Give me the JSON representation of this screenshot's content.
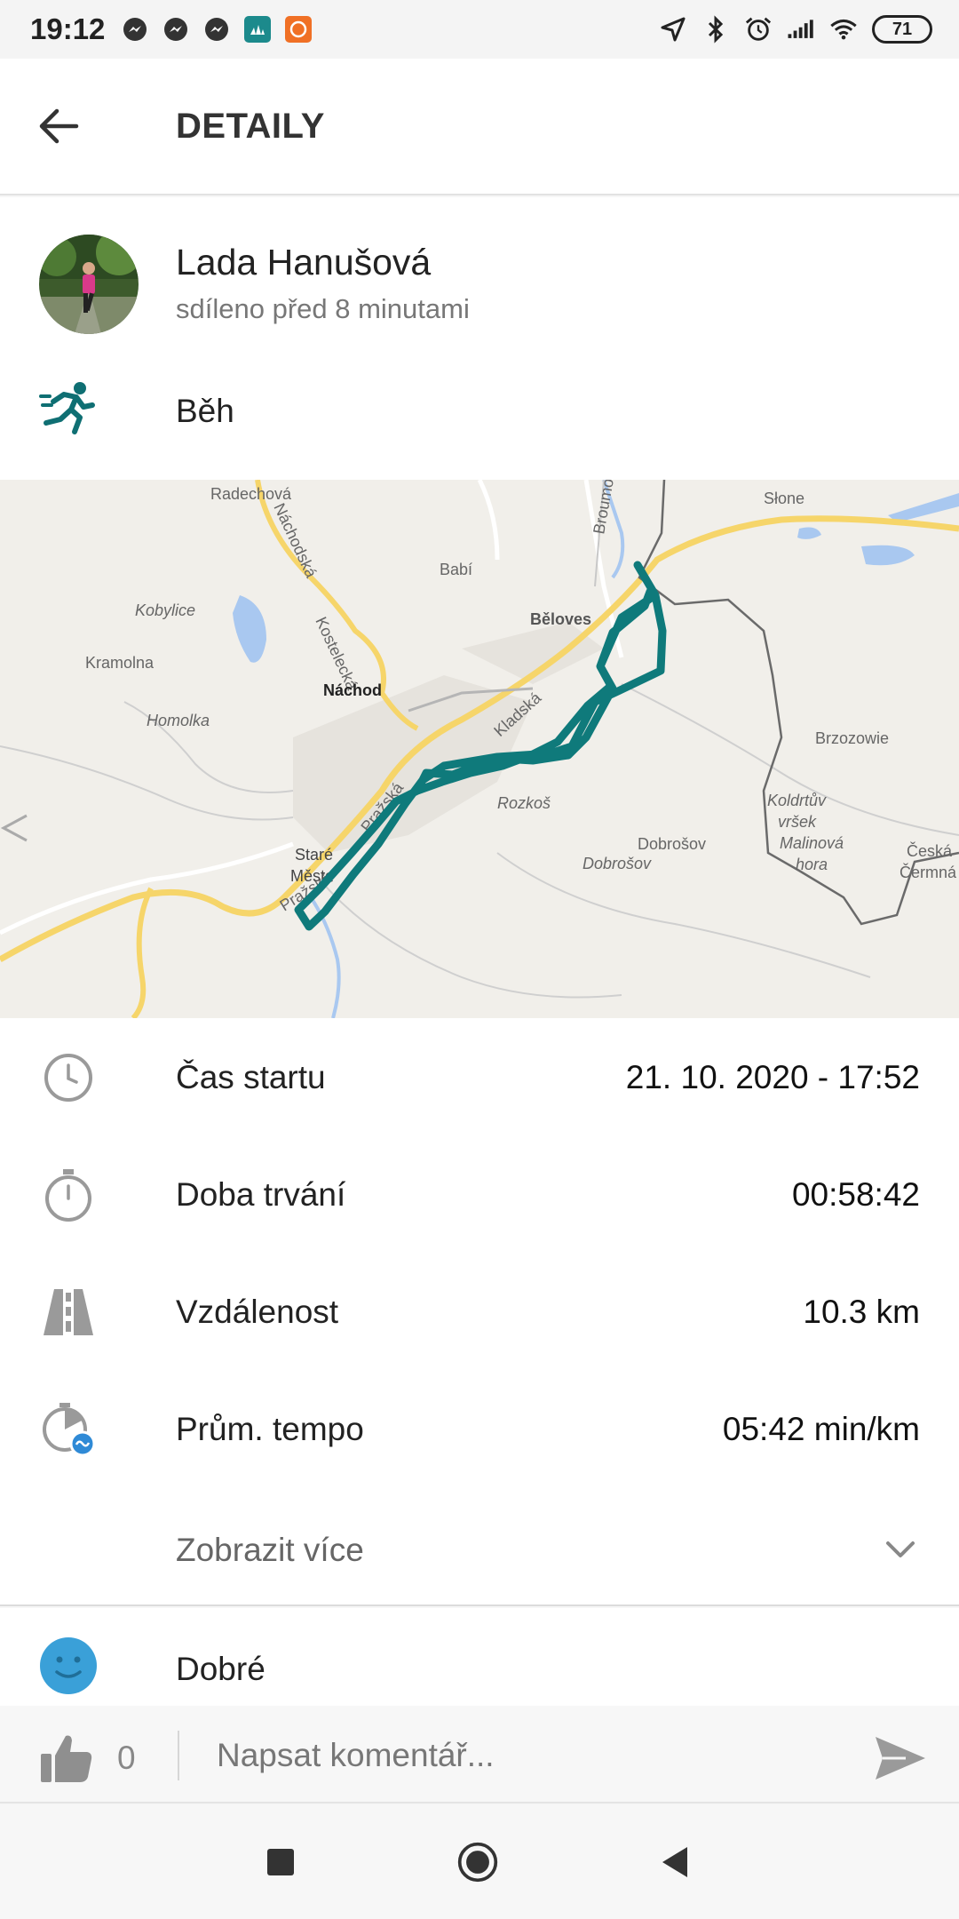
{
  "status_bar": {
    "time": "19:12",
    "battery": "71",
    "left_icons": [
      "messenger-icon",
      "messenger-icon",
      "messenger-icon",
      "adidas-app-icon",
      "mi-app-icon"
    ],
    "right_icons": [
      "location-icon",
      "bluetooth-icon",
      "alarm-icon",
      "signal-icon",
      "wifi-icon",
      "battery-icon"
    ]
  },
  "header": {
    "title": "DETAILY"
  },
  "user": {
    "name": "Lada Hanušová",
    "subtitle": "sdíleno před 8 minutami"
  },
  "activity": {
    "type": "Běh"
  },
  "map": {
    "labels": {
      "radechova": "Radechová",
      "nachodska": "Náchodská",
      "babi": "Babí",
      "bromov": "Broumo",
      "slone": "Słone",
      "kostelecka": "Kostelecká",
      "kobylice": "Kobylice",
      "beloves": "Běloves",
      "kladska": "Kladská",
      "kramolna": "Kramolna",
      "nachod": "Náchod",
      "homolka": "Homolka",
      "prazska1": "Pražská",
      "prazska2": "Pražská",
      "brzozowie": "Brzozowie",
      "koldrtuv": "Koldrtův",
      "vrsek": "vršek",
      "malinova": "Malinová",
      "hora": "hora",
      "rozkos": "Rozkoš",
      "dobrosov1": "Dobrošov",
      "dobrosov2": "Dobrošov",
      "stare": "Staré",
      "mesto": "Město",
      "ceska": "Česká",
      "cermna": "Čermná"
    },
    "route_color": "#0f7a7b"
  },
  "details": {
    "rows": [
      {
        "label": "Čas startu",
        "value": "21. 10. 2020 - 17:52",
        "icon": "clock-icon"
      },
      {
        "label": "Doba trvání",
        "value": "00:58:42",
        "icon": "stopwatch-icon"
      },
      {
        "label": "Vzdálenost",
        "value": "10.3 km",
        "icon": "road-icon"
      },
      {
        "label": "Prům. tempo",
        "value": "05:42 min/km",
        "icon": "pace-icon"
      }
    ],
    "show_more": "Zobrazit více"
  },
  "mood": {
    "label": "Dobré"
  },
  "comment_bar": {
    "like_count": "0",
    "placeholder": "Napsat komentář..."
  },
  "colors": {
    "accent": "#0f7a7b",
    "mood": "#3aa0d8",
    "icon_gray": "#9a9a9a"
  }
}
